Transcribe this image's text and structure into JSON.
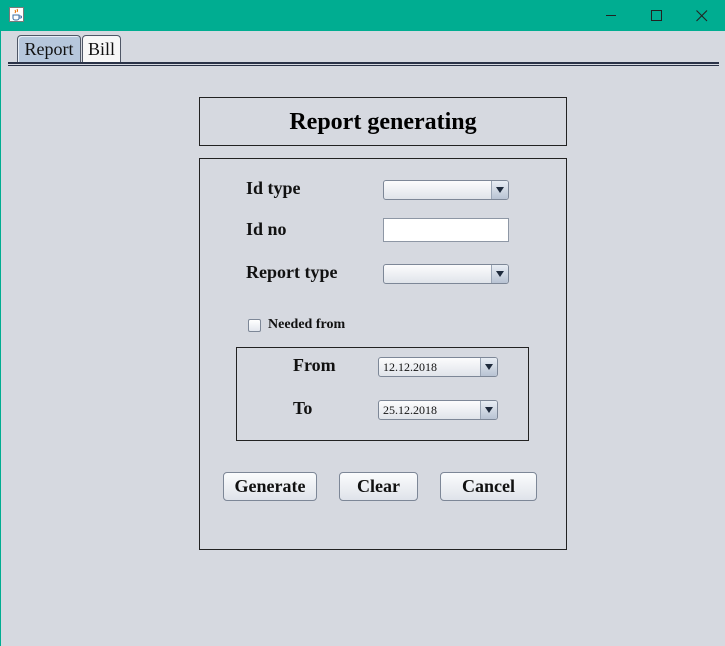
{
  "tabs": [
    {
      "label": "Report",
      "selected": true
    },
    {
      "label": "Bill",
      "selected": false
    }
  ],
  "form": {
    "title": "Report generating",
    "id_type_label": "Id type",
    "id_type_value": "",
    "id_no_label": "Id no",
    "id_no_value": "",
    "report_type_label": "Report type",
    "report_type_value": "",
    "needed_from_label": "Needed from",
    "needed_from_checked": false,
    "from_label": "From",
    "from_value": "12.12.2018",
    "to_label": "To",
    "to_value": "25.12.2018"
  },
  "buttons": {
    "generate": "Generate",
    "clear": "Clear",
    "cancel": "Cancel"
  },
  "colors": {
    "titlebar": "#00ad91",
    "background": "#d6d9e0",
    "selected_tab": "#b6c7dc"
  },
  "icons": {
    "app": "java-coffee-icon",
    "minimize": "minimize-icon",
    "maximize": "maximize-icon",
    "close": "close-icon"
  }
}
